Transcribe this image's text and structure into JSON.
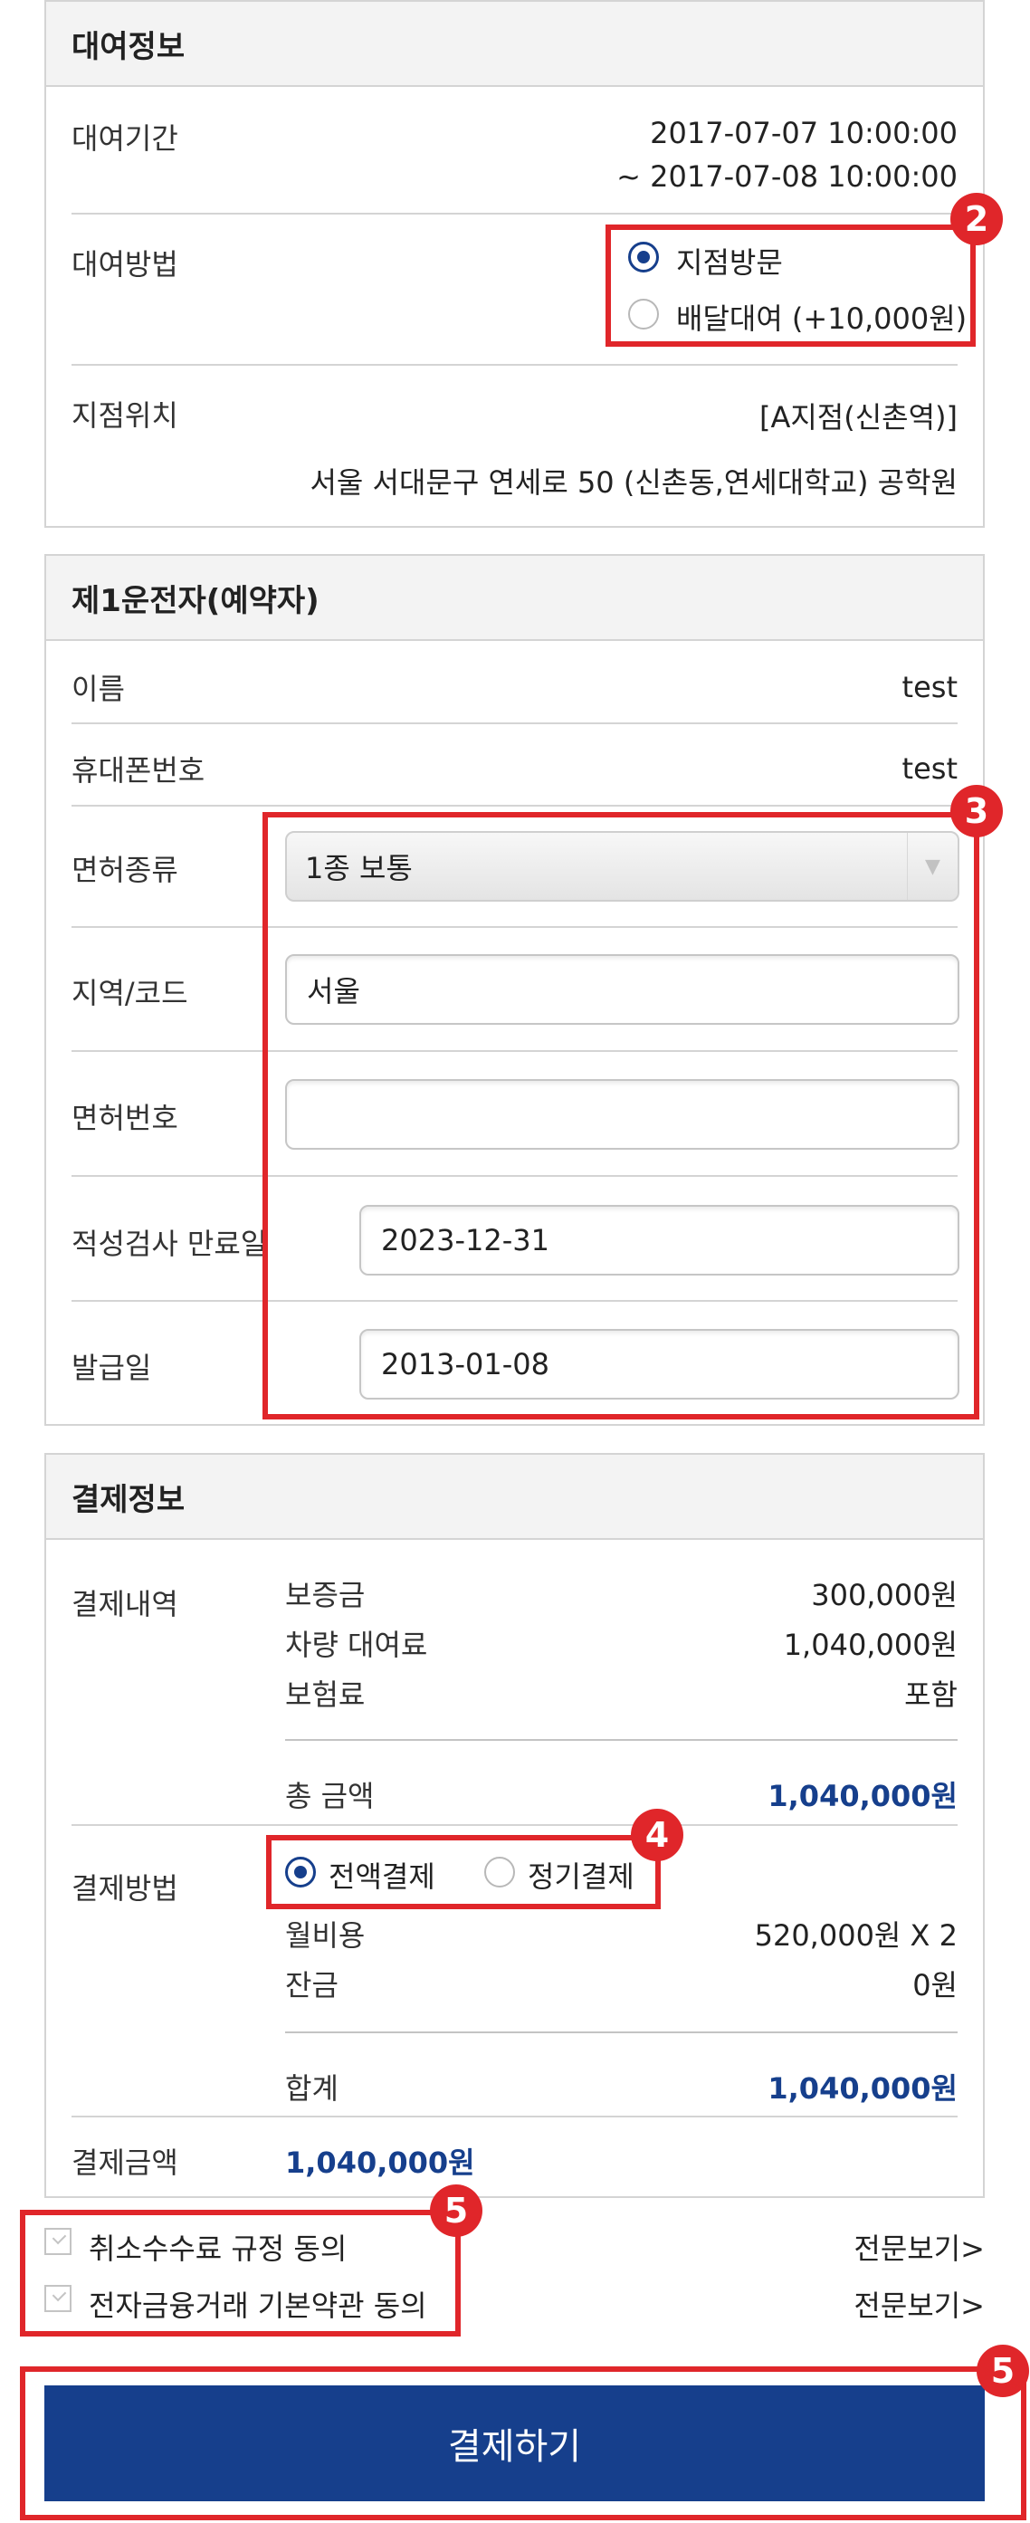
{
  "rental": {
    "header": "대여정보",
    "period_label": "대여기간",
    "period_start": "2017-07-07 10:00:00",
    "period_end": "~ 2017-07-08 10:00:00",
    "method_label": "대여방법",
    "method_options": [
      "지점방문",
      "배달대여 (+10,000원)"
    ],
    "method_selected": "지점방문",
    "location_label": "지점위치",
    "branch_name": "[A지점(신촌역)]",
    "branch_address": "서울 서대문구 연세로 50 (신촌동,연세대학교) 공학원"
  },
  "driver": {
    "header": "제1운전자(예약자)",
    "name_label": "이름",
    "name_value": "test",
    "phone_label": "휴대폰번호",
    "phone_value": "test",
    "license_type_label": "면허종류",
    "license_type_value": "1종 보통",
    "region_label": "지역/코드",
    "region_value": "서울",
    "license_no_label": "면허번호",
    "license_no_value": "",
    "aptitude_label": "적성검사 만료일",
    "aptitude_value": "2023-12-31",
    "issue_label": "발급일",
    "issue_value": "2013-01-08"
  },
  "payment": {
    "header": "결제정보",
    "details_label": "결제내역",
    "deposit_label": "보증금",
    "deposit_value": "300,000원",
    "rent_label": "차량 대여료",
    "rent_value": "1,040,000원",
    "insurance_label": "보험료",
    "insurance_value": "포함",
    "total_label": "총 금액",
    "total_value": "1,040,000원",
    "method_label": "결제방법",
    "method_options": [
      "전액결제",
      "정기결제"
    ],
    "method_selected": "전액결제",
    "monthly_label": "월비용",
    "monthly_value": "520,000원 X 2",
    "balance_label": "잔금",
    "balance_value": "0원",
    "sum_label": "합계",
    "sum_value": "1,040,000원",
    "amount_label": "결제금액",
    "amount_value": "1,040,000원"
  },
  "agreements": [
    {
      "label": "취소수수료 규정 동의",
      "link": "전문보기>"
    },
    {
      "label": "전자금융거래 기본약관 동의",
      "link": "전문보기>"
    }
  ],
  "pay_button": "결제하기",
  "annotations": [
    "2",
    "3",
    "4",
    "5",
    "5"
  ],
  "colors": {
    "accent": "#163f8c",
    "highlight": "#e0262a",
    "border": "#d4d4d4",
    "header_bg": "#f3f3f3"
  }
}
